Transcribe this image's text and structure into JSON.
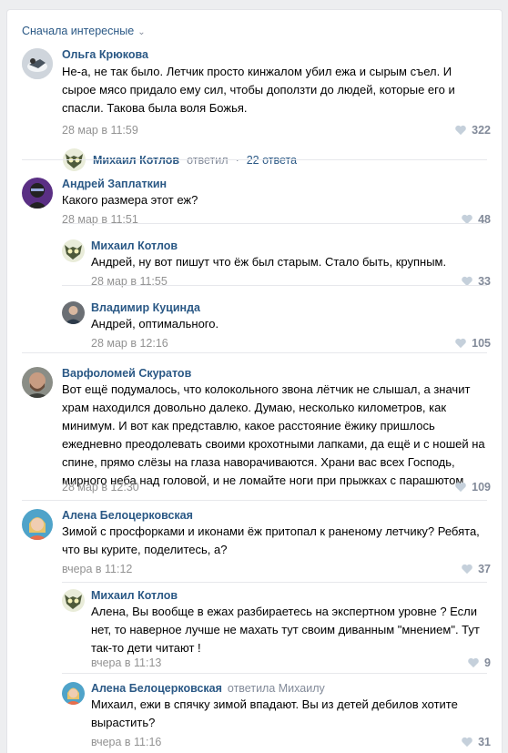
{
  "sort_label": "Сначала интересные",
  "colors": {
    "link": "#2a5885",
    "muted": "#939393",
    "bg": "#edeef0"
  },
  "comments": [
    {
      "author": "Ольга Крюкова",
      "text": "Не-а, не так было. Летчик просто кинжалом убил ежа и сырым съел. И сырое мясо придало ему сил, чтобы доползти до людей, которые его и спасли. Такова была воля Божья.",
      "date": "28 мар в 11:59",
      "likes": "322",
      "reply_preview": {
        "author": "Михаил Котлов",
        "verb": "ответил",
        "count": "22 ответа"
      }
    },
    {
      "author": "Андрей Заплаткин",
      "text": "Какого размера этот еж?",
      "date": "28 мар в 11:51",
      "likes": "48"
    },
    {
      "author": "Михаил Котлов",
      "text": "Андрей, ну вот пишут что ёж был старым. Стало быть, крупным.",
      "date": "28 мар в 11:55",
      "likes": "33"
    },
    {
      "author": "Владимир Куцинда",
      "text": "Андрей, оптимального.",
      "date": "28 мар в 12:16",
      "likes": "105"
    },
    {
      "author": "Варфоломей Скуратов",
      "text": "Вот ещё подумалось, что колокольного звона лётчик не слышал, а значит храм находился довольно далеко. Думаю, несколько километров, как минимум. И вот как представлю, какое расстояние ёжику пришлось ежедневно преодолевать своими крохотными лапками, да ещё и с ношей на спине, прямо слёзы на глаза наворачиваются. Храни вас всех Господь, мирного неба над головой, и не ломайте ноги при прыжках с парашютом",
      "date": "28 мар в 12:30",
      "likes": "109"
    },
    {
      "author": "Алена Белоцерковская",
      "text": "Зимой с просфорками и иконами ёж притопал к раненому летчику? Ребята, что вы курите, поделитесь, а?",
      "date": "вчера в 11:12",
      "likes": "37"
    },
    {
      "author": "Михаил Котлов",
      "text": "Алена, Вы вообще в ежах разбираетесь на экспертном уровне ? Если нет, то наверное лучше не махать тут своим диванным \"мнением\". Тут так-то дети читают !",
      "date": "вчера в 11:13",
      "likes": "9"
    },
    {
      "author": "Алена Белоцерковская",
      "verb": "ответила Михаилу",
      "text": "Михаил, ежи в спячку зимой впадают. Вы из детей дебилов хотите вырастить?",
      "date": "вчера в 11:16",
      "likes": "31"
    }
  ]
}
